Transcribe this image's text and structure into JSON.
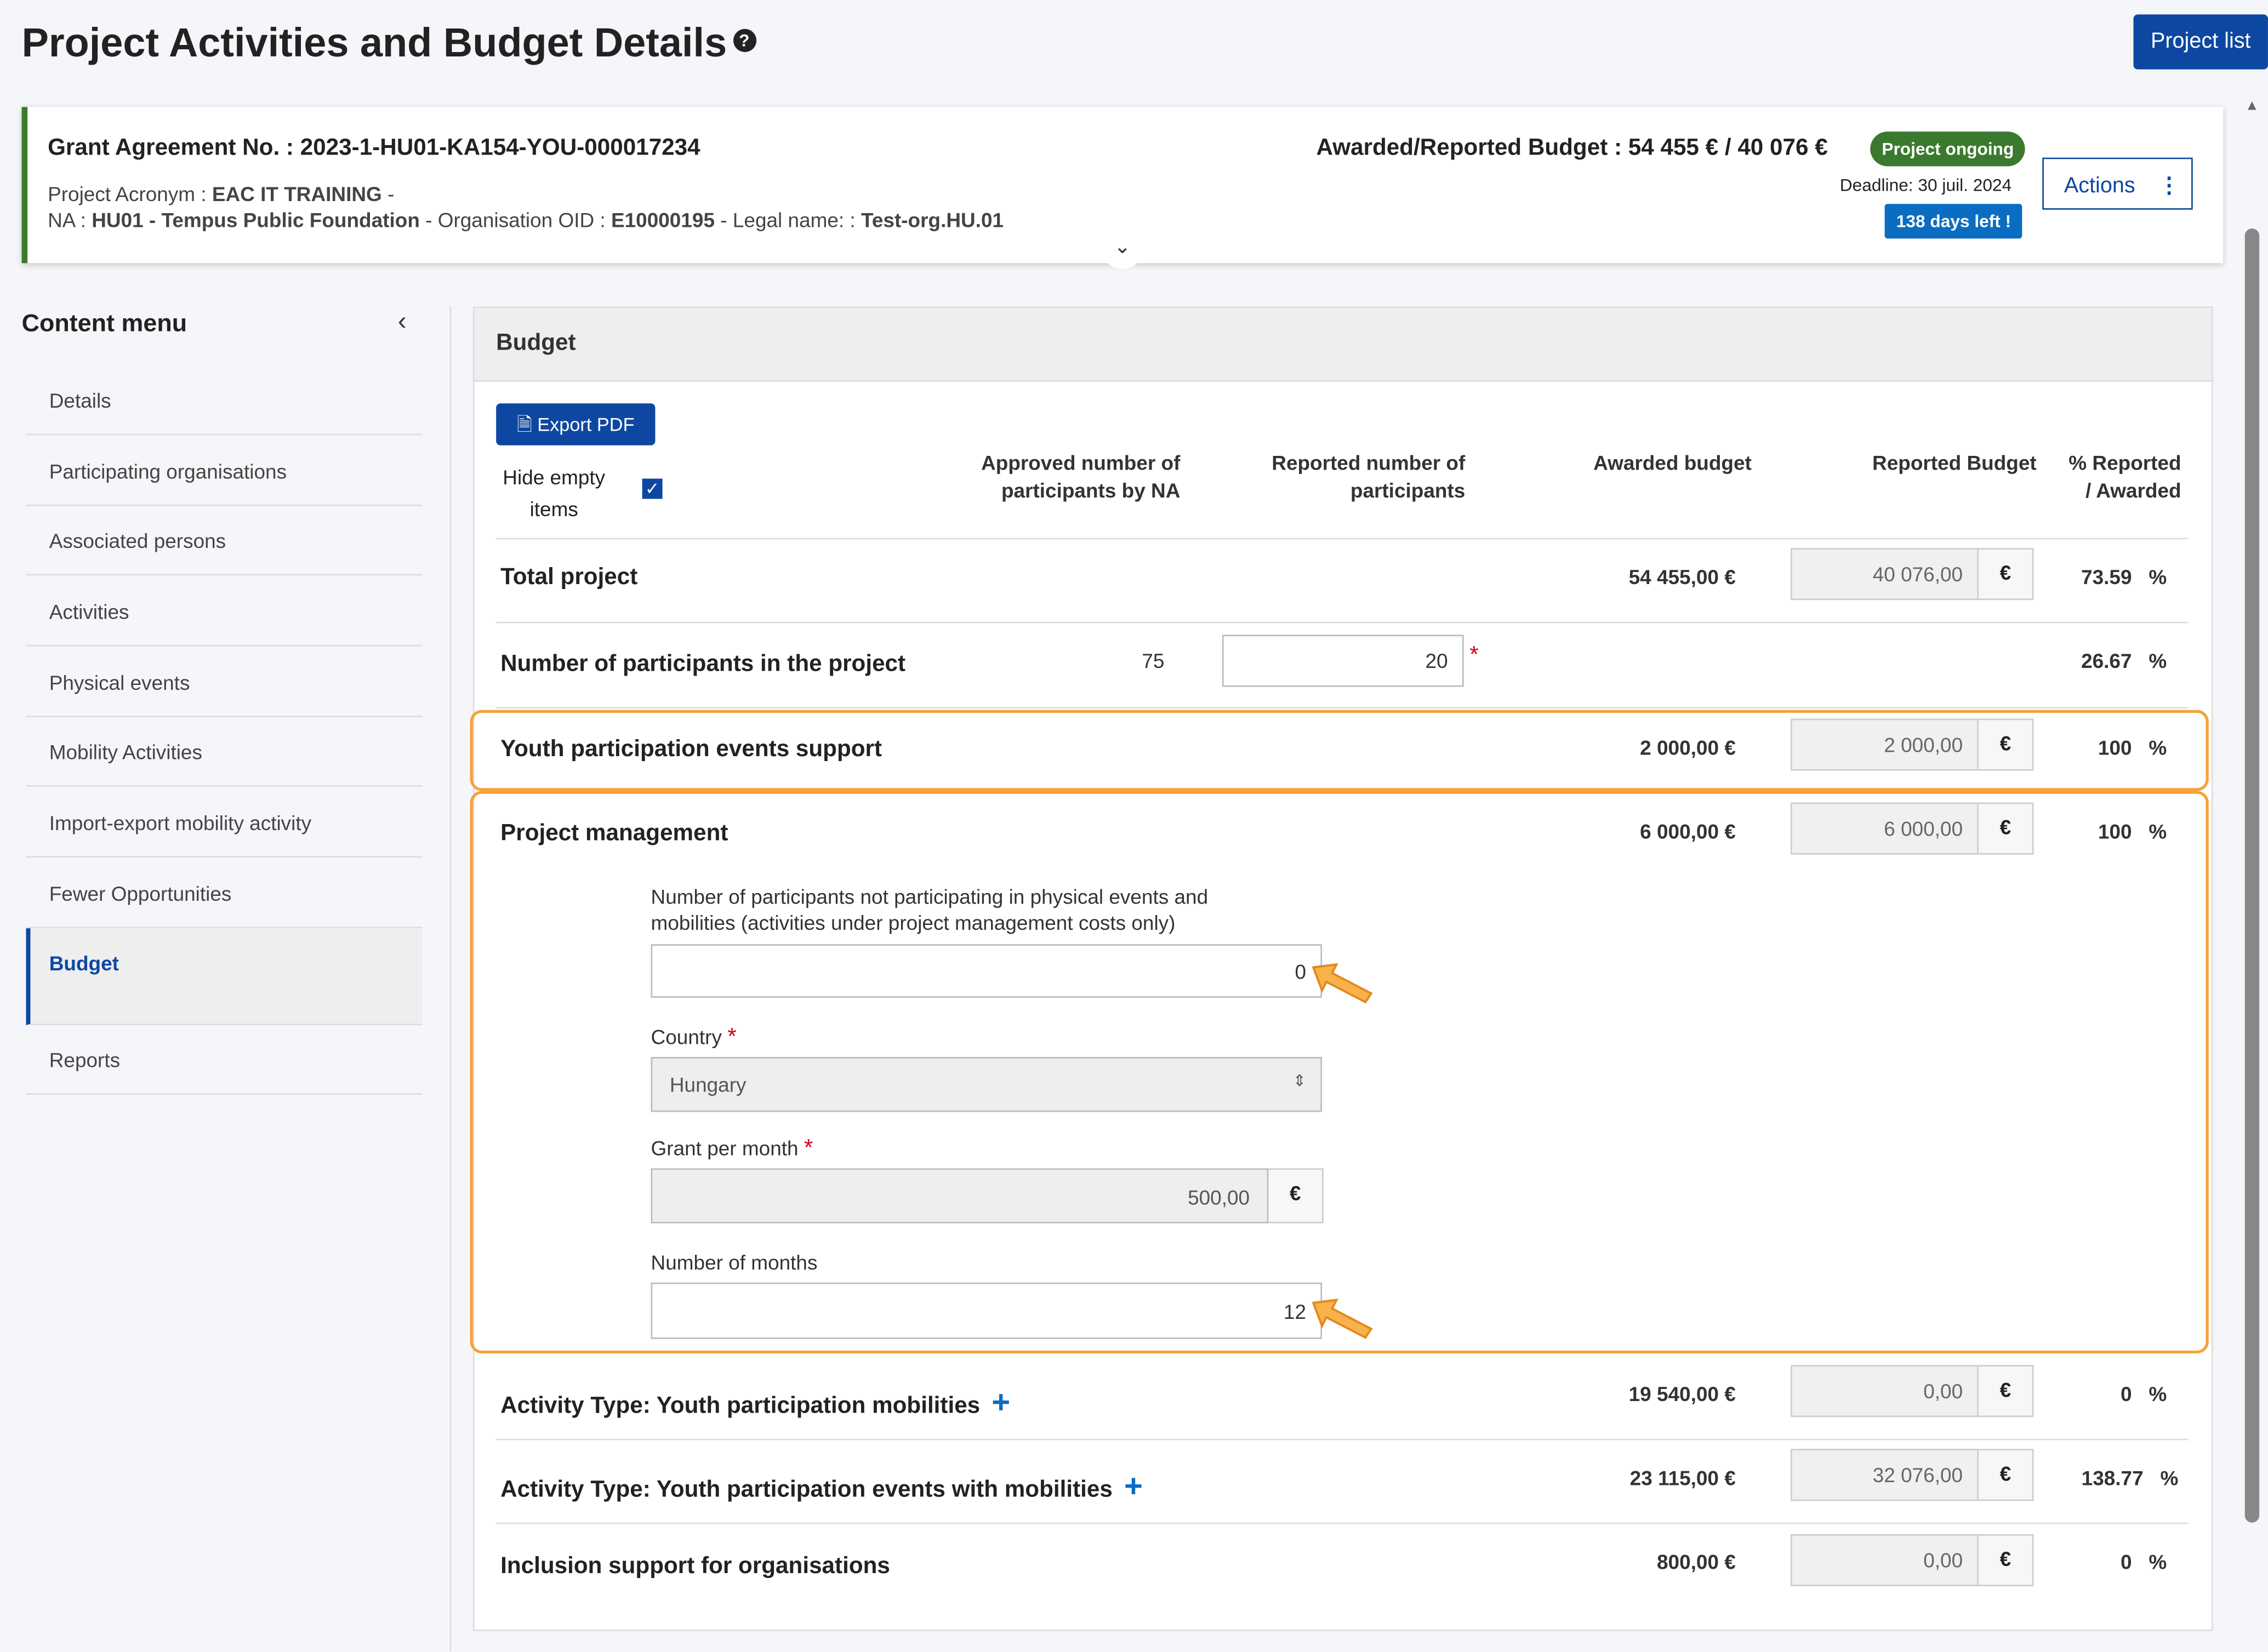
{
  "page": {
    "title": "Project Activities and Budget Details",
    "project_list_label": "Project list"
  },
  "header": {
    "grant_label": "Grant Agreement No. : 2023-1-HU01-KA154-YOU-000017234",
    "acronym_label": "Project Acronym : ",
    "acronym": "EAC IT TRAINING",
    "acronym_suffix": " -",
    "na_label": "NA : ",
    "na": "HU01 - Tempus Public Foundation",
    "org_label": " - Organisation OID : ",
    "org": "E10000195",
    "legal_label": " - Legal name: : ",
    "legal": "Test-org.HU.01",
    "budget": "Awarded/Reported Budget : 54 455 € / 40 076 €",
    "status": "Project ongoing",
    "deadline": "Deadline: 30 juil. 2024",
    "days_left": "138 days left !",
    "actions": "Actions"
  },
  "sidebar": {
    "title": "Content menu",
    "items": [
      {
        "label": "Details"
      },
      {
        "label": "Participating organisations"
      },
      {
        "label": "Associated persons"
      },
      {
        "label": "Activities"
      },
      {
        "label": "Physical events"
      },
      {
        "label": "Mobility Activities"
      },
      {
        "label": "Import-export mobility activity"
      },
      {
        "label": "Fewer Opportunities"
      },
      {
        "label": "Budget"
      },
      {
        "label": "Reports"
      }
    ],
    "active": "Budget"
  },
  "budget": {
    "title": "Budget",
    "export_label": "Export PDF",
    "hide_empty_label": "Hide empty items",
    "hide_empty_checked": true,
    "columns": {
      "approved": "Approved number of participants by NA",
      "reported": "Reported number of participants",
      "awarded": "Awarded budget",
      "reported_budget": "Reported Budget",
      "pct": "% Reported / Awarded"
    },
    "currency": "€",
    "pct_sign": "%",
    "rows": [
      {
        "label": "Total project",
        "awarded": "54 455,00 €",
        "reported": "40 076,00",
        "pct": "73.59"
      },
      {
        "label": "Number of participants in the project",
        "approved": "75",
        "reported_participants": "20",
        "pct": "26.67"
      },
      {
        "label": "Youth participation events support",
        "awarded": "2 000,00 €",
        "reported": "2 000,00",
        "pct": "100"
      },
      {
        "label": "Project management",
        "awarded": "6 000,00 €",
        "reported": "6 000,00",
        "pct": "100"
      },
      {
        "label": "Activity Type: Youth participation mobilities",
        "awarded": "19 540,00 €",
        "reported": "0,00",
        "pct": "0"
      },
      {
        "label": "Activity Type: Youth participation events with mobilities",
        "awarded": "23 115,00 €",
        "reported": "32 076,00",
        "pct": "138.77"
      },
      {
        "label": "Inclusion support for organisations",
        "awarded": "800,00 €",
        "reported": "0,00",
        "pct": "0"
      }
    ],
    "pm": {
      "participants_label": "Number of participants not participating in physical events and mobilities (activities under project management costs only)",
      "participants_value": "0",
      "country_label": "Country",
      "country_value": "Hungary",
      "grant_label": "Grant per month",
      "grant_value": "500,00",
      "months_label": "Number of months",
      "months_value": "12"
    }
  },
  "colors": {
    "primary": "#0e47a1",
    "highlight": "#f5a23a",
    "status_green": "#3b7a2e",
    "days_blue": "#0a6dc2"
  }
}
